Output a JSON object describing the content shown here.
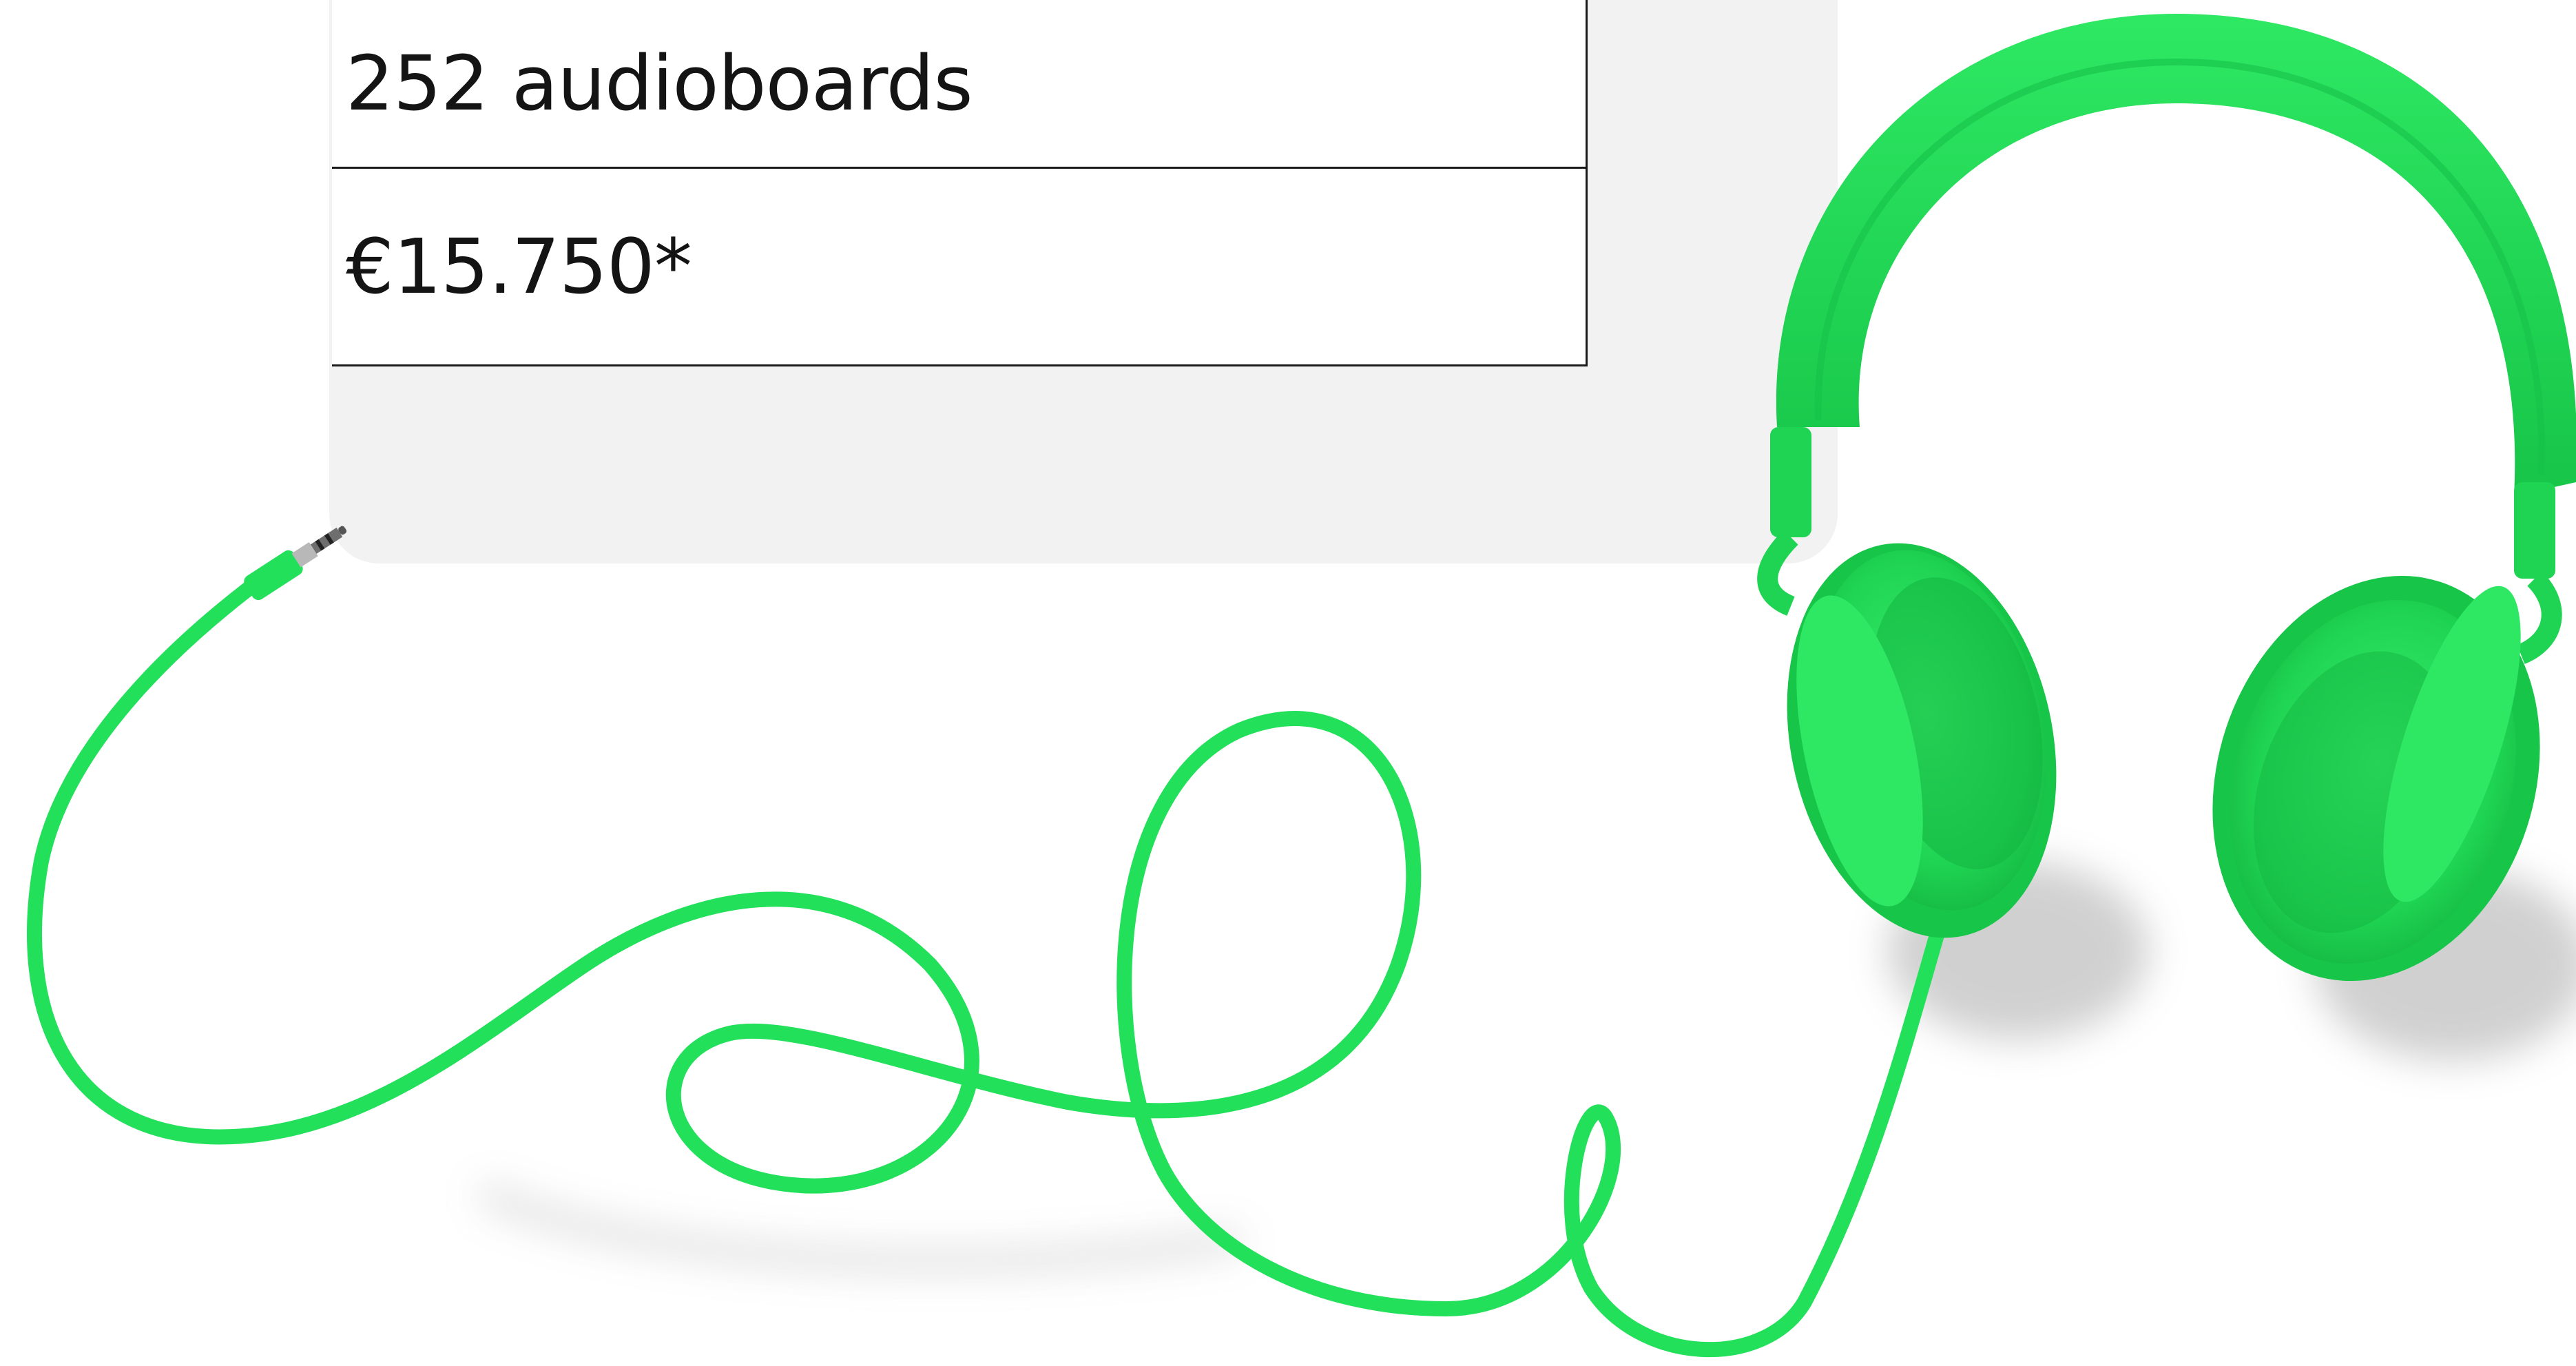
{
  "specs": {
    "rows": [
      {
        "label": "252 audioboards"
      },
      {
        "label": "€15.750*"
      }
    ]
  },
  "colors": {
    "headphone_green": "#22e05a",
    "headphone_shadow": "#13b83f",
    "panel_background": "#f2f2f2",
    "table_line": "#1a1a1a",
    "text": "#141414"
  },
  "image": {
    "subject": "headphones-icon"
  }
}
